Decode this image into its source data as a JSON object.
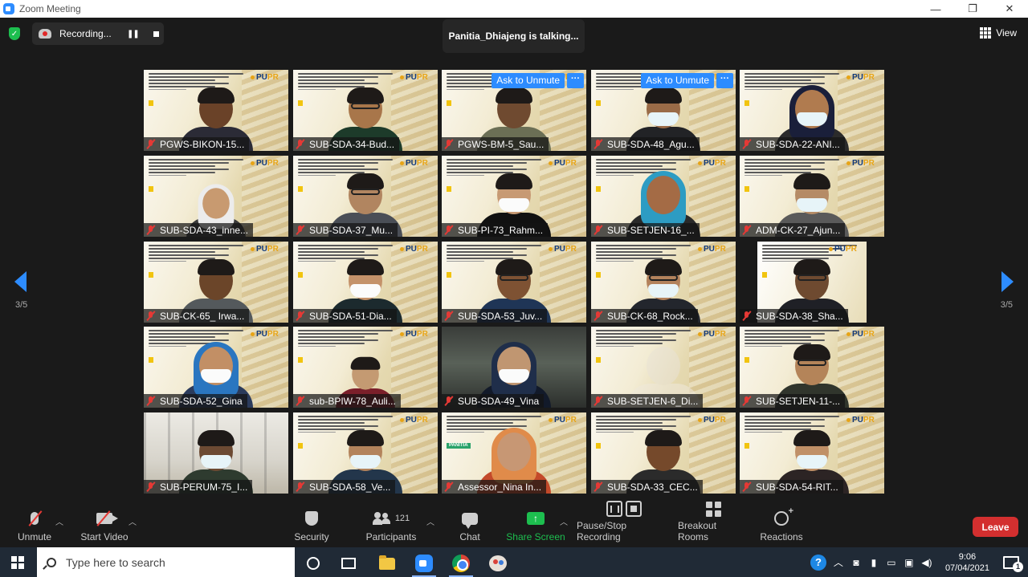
{
  "window": {
    "title": "Zoom Meeting",
    "controls": [
      "minimize",
      "restore",
      "close"
    ]
  },
  "status": {
    "recording_label": "Recording...",
    "talking": "Panitia_Dhiajeng is talking...",
    "view_label": "View"
  },
  "pager": {
    "current": "3/5"
  },
  "tile_texts": {
    "ask_unmute": "Ask to Unmute",
    "more": "···",
    "panitia_badge": "PANITIA",
    "logo_pu": "PU",
    "logo_pr": "PR"
  },
  "participants": [
    {
      "name": "PGWS-BIKON-15...",
      "ask": false
    },
    {
      "name": "SUB-SDA-34-Bud...",
      "ask": false
    },
    {
      "name": "PGWS-BM-5_Sau...",
      "ask": true
    },
    {
      "name": "SUB-SDA-48_Agu...",
      "ask": true
    },
    {
      "name": "SUB-SDA-22-ANI...",
      "ask": false
    },
    {
      "name": "SUB-SDA-43_inne...",
      "ask": false
    },
    {
      "name": "SUB-SDA-37_Mu...",
      "ask": false
    },
    {
      "name": "SUB-PI-73_Rahm...",
      "ask": false
    },
    {
      "name": "SUB-SETJEN-16_...",
      "ask": false
    },
    {
      "name": "ADM-CK-27_Ajun...",
      "ask": false
    },
    {
      "name": "SUB-CK-65_ Irwa...",
      "ask": false
    },
    {
      "name": "SUB-SDA-51-Dia...",
      "ask": false
    },
    {
      "name": "SUB-SDA-53_Juv...",
      "ask": false
    },
    {
      "name": "SUB-CK-68_Rock...",
      "ask": false
    },
    {
      "name": "SUB-SDA-38_Sha...",
      "ask": false
    },
    {
      "name": "SUB-SDA-52_Gina",
      "ask": false
    },
    {
      "name": "sub-BPIW-78_Auli...",
      "ask": false
    },
    {
      "name": "SUB-SDA-49_Vina",
      "ask": false
    },
    {
      "name": "SUB-SETJEN-6_Di...",
      "ask": false
    },
    {
      "name": "SUB-SETJEN-11-...",
      "ask": false
    },
    {
      "name": "SUB-PERUM-75_I...",
      "ask": false
    },
    {
      "name": "SUB-SDA-58_Ve...",
      "ask": false
    },
    {
      "name": "Assessor_Nina In...",
      "ask": false
    },
    {
      "name": "SUB-SDA-33_CEC...",
      "ask": false
    },
    {
      "name": "SUB-SDA-54-RIT...",
      "ask": false
    }
  ],
  "toolbar": {
    "unmute": "Unmute",
    "start_video": "Start Video",
    "security": "Security",
    "participants": "Participants",
    "participants_count": "121",
    "chat": "Chat",
    "share_screen": "Share Screen",
    "pause_stop_recording": "Pause/Stop Recording",
    "breakout_rooms": "Breakout Rooms",
    "reactions": "Reactions",
    "leave": "Leave"
  },
  "taskbar": {
    "search_placeholder": "Type here to search",
    "time": "9:06",
    "date": "07/04/2021",
    "notifications": "1"
  },
  "colors": {
    "zoom_blue": "#2d8cff",
    "share_green": "#1dbe4f",
    "leave_red": "#d32f2f",
    "mute_red": "#e53935",
    "taskbar": "#202a36"
  }
}
